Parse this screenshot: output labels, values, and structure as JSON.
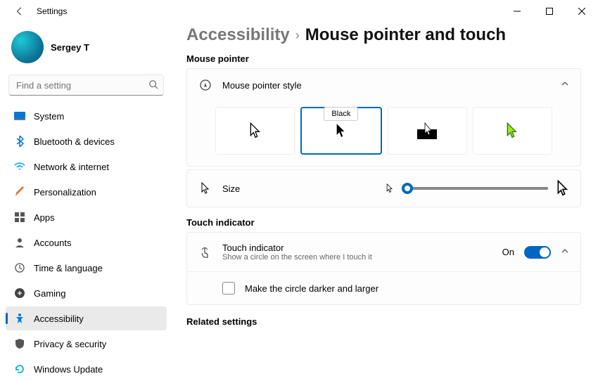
{
  "window": {
    "title": "Settings"
  },
  "user": {
    "name": "Sergey T"
  },
  "search": {
    "placeholder": "Find a setting"
  },
  "nav": {
    "items": [
      {
        "label": "System"
      },
      {
        "label": "Bluetooth & devices"
      },
      {
        "label": "Network & internet"
      },
      {
        "label": "Personalization"
      },
      {
        "label": "Apps"
      },
      {
        "label": "Accounts"
      },
      {
        "label": "Time & language"
      },
      {
        "label": "Gaming"
      },
      {
        "label": "Accessibility"
      },
      {
        "label": "Privacy & security"
      },
      {
        "label": "Windows Update"
      }
    ],
    "active_index": 8
  },
  "breadcrumb": {
    "parent": "Accessibility",
    "current": "Mouse pointer and touch"
  },
  "sections": {
    "mouse_pointer_label": "Mouse pointer",
    "style_card_title": "Mouse pointer style",
    "style_tooltip": "Black",
    "size_label": "Size",
    "touch_label": "Touch indicator",
    "touch_card_title": "Touch indicator",
    "touch_card_sub": "Show a circle on the screen where I touch it",
    "touch_state": "On",
    "touch_checkbox_label": "Make the circle darker and larger",
    "related_label": "Related settings"
  },
  "slider": {
    "value_percent": 4
  }
}
